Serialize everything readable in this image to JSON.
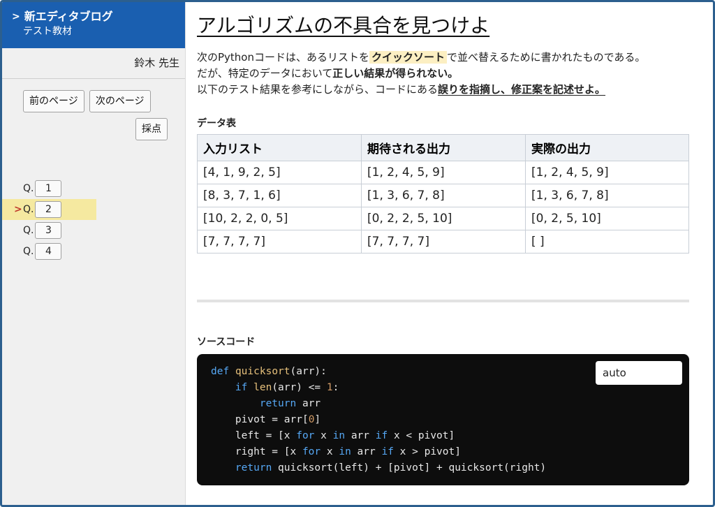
{
  "sidebar": {
    "title": "新エディタブログ",
    "subtitle": "テスト教材",
    "teacher": "鈴木 先生",
    "prev_label": "前のページ",
    "next_label": "次のページ",
    "grade_label": "採点",
    "question_prefix": "Q.",
    "questions": [
      "1",
      "2",
      "3",
      "4"
    ],
    "active_question": "2"
  },
  "main": {
    "title": "アルゴリズムの不具合を見つけよ",
    "desc1_pre": "次のPythonコードは、あるリストを",
    "desc1_hl": "クイックソート",
    "desc1_post": "で並べ替えるために書かれたものである。",
    "desc2_pre": "だが、特定のデータにおいて",
    "desc2_bold": "正しい結果が得られない。",
    "desc3_pre": "以下のテスト結果を参考にしながら、コードにある",
    "desc3_ul": "誤りを指摘し、修正案を記述せよ。",
    "table_label": "データ表",
    "table": {
      "headers": [
        "入力リスト",
        "期待される出力",
        "実際の出力"
      ],
      "rows": [
        [
          "[4, 1, 9, 2, 5]",
          "[1, 2, 4, 5, 9]",
          "[1, 2, 4, 5, 9]"
        ],
        [
          "[8, 3, 7, 1, 6]",
          "[1, 3, 6, 7, 8]",
          "[1, 3, 6, 7, 8]"
        ],
        [
          "[10, 2, 2, 0, 5]",
          "[0, 2, 2, 5, 10]",
          "[0, 2, 5, 10]"
        ],
        [
          "[7, 7, 7, 7]",
          "[7, 7, 7, 7]",
          "[ ]"
        ]
      ]
    },
    "code_label": "ソースコード",
    "language_select": "auto"
  }
}
